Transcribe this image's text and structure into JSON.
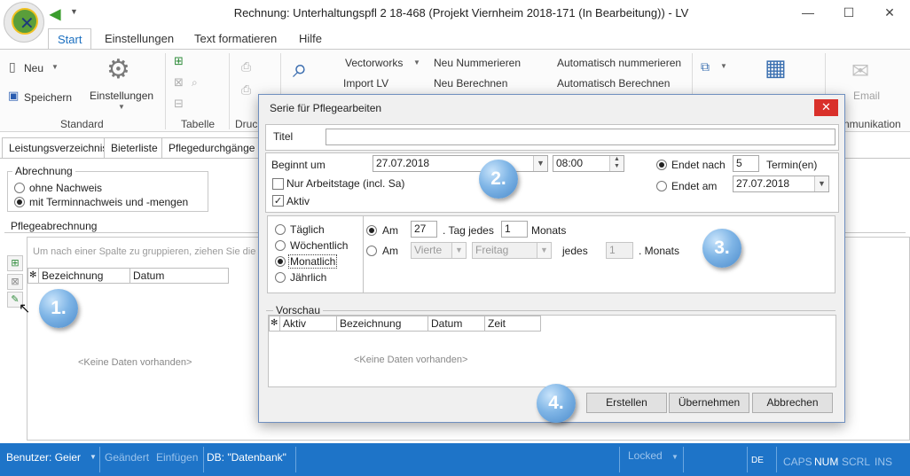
{
  "window": {
    "title": "Rechnung:  Unterhaltungspfl 2 18-468 (Projekt Viernheim 2018-171 (In Bearbeitung)) - LV",
    "minimize": "—",
    "maximize": "☐",
    "close": "✕"
  },
  "ribbon_tabs": [
    "Start",
    "Einstellungen",
    "Text formatieren",
    "Hilfe"
  ],
  "ribbon": {
    "neu": "Neu",
    "speichern": "Speichern",
    "einstellungen": "Einstellungen",
    "group_standard": "Standard",
    "group_tabelle": "Tabelle",
    "group_druck": "Druc",
    "vectorworks": "Vectorworks",
    "import_lv": "Import LV",
    "neu_nummerieren": "Neu Nummerieren",
    "neu_berechnen": "Neu Berechnen",
    "auto_nummerieren": "Automatisch nummerieren",
    "auto_berechnen": "Automatisch Berechnen",
    "email": "Email",
    "group_kommunikation": "nmunikation"
  },
  "doc_tabs": [
    "Leistungsverzeichnis",
    "Bieterliste",
    "Pflegedurchgänge"
  ],
  "abrechnung": {
    "title": "Abrechnung",
    "options": [
      "ohne Nachweis",
      "mit Terminnachweis und -mengen"
    ],
    "selected_index": 1
  },
  "pflegeabrechnung": {
    "title": "Pflegeabrechnung",
    "group_hint": "Um nach einer Spalte zu gruppieren, ziehen Sie die Sp",
    "columns": [
      "Bezeichnung",
      "Datum"
    ],
    "empty": "<Keine Daten vorhanden>"
  },
  "dialog": {
    "title": "Serie für Pflegearbeiten",
    "close": "✕",
    "titel_label": "Titel",
    "titel_value": "",
    "beginnt_label": "Beginnt um",
    "beginnt_date": "27.07.2018",
    "beginnt_time": "08:00",
    "arbeitstage_label": "Nur Arbeitstage (incl. Sa)",
    "arbeitstage_checked": false,
    "aktiv_label": "Aktiv",
    "aktiv_checked": true,
    "endet_nach_label": "Endet nach",
    "endet_nach_value": "5",
    "termine_label": "Termin(en)",
    "endet_am_label": "Endet am",
    "endet_am_value": "27.07.2018",
    "endet_selected": "nach",
    "frequency": [
      "Täglich",
      "Wöchentlich",
      "Monatlich",
      "Jährlich"
    ],
    "frequency_selected_index": 2,
    "monthly": {
      "am_label": "Am",
      "day_value": "27",
      "tag_jedes_label": ". Tag jedes",
      "months_value": "1",
      "monats_label": "Monats",
      "am2_label": "Am",
      "ordinal_value": "Vierte",
      "weekday_value": "Freitag",
      "jedes_label": "jedes",
      "months2_value": "1",
      "monats2_label": ". Monats",
      "selected": 0
    },
    "vorschau_title": "Vorschau",
    "vorschau_columns": [
      "Aktiv",
      "Bezeichnung",
      "Datum",
      "Zeit"
    ],
    "vorschau_empty": "<Keine Daten vorhanden>",
    "buttons": [
      "Erstellen",
      "Übernehmen",
      "Abbrechen"
    ]
  },
  "bubbles": [
    "1.",
    "2.",
    "3.",
    "4."
  ],
  "status": {
    "benutzer": "Benutzer: Geier",
    "geaendert": "Geändert",
    "einfuegen": "Einfügen",
    "db": "DB: \"Datenbank\"",
    "locked": "Locked",
    "lang": "DE",
    "caps": "CAPS",
    "num": "NUM",
    "scrl": "SCRL",
    "ins": "INS"
  },
  "colors": {
    "accent": "#1b6fc0",
    "status_bar": "#1e74c8",
    "close_red": "#d9302a"
  }
}
